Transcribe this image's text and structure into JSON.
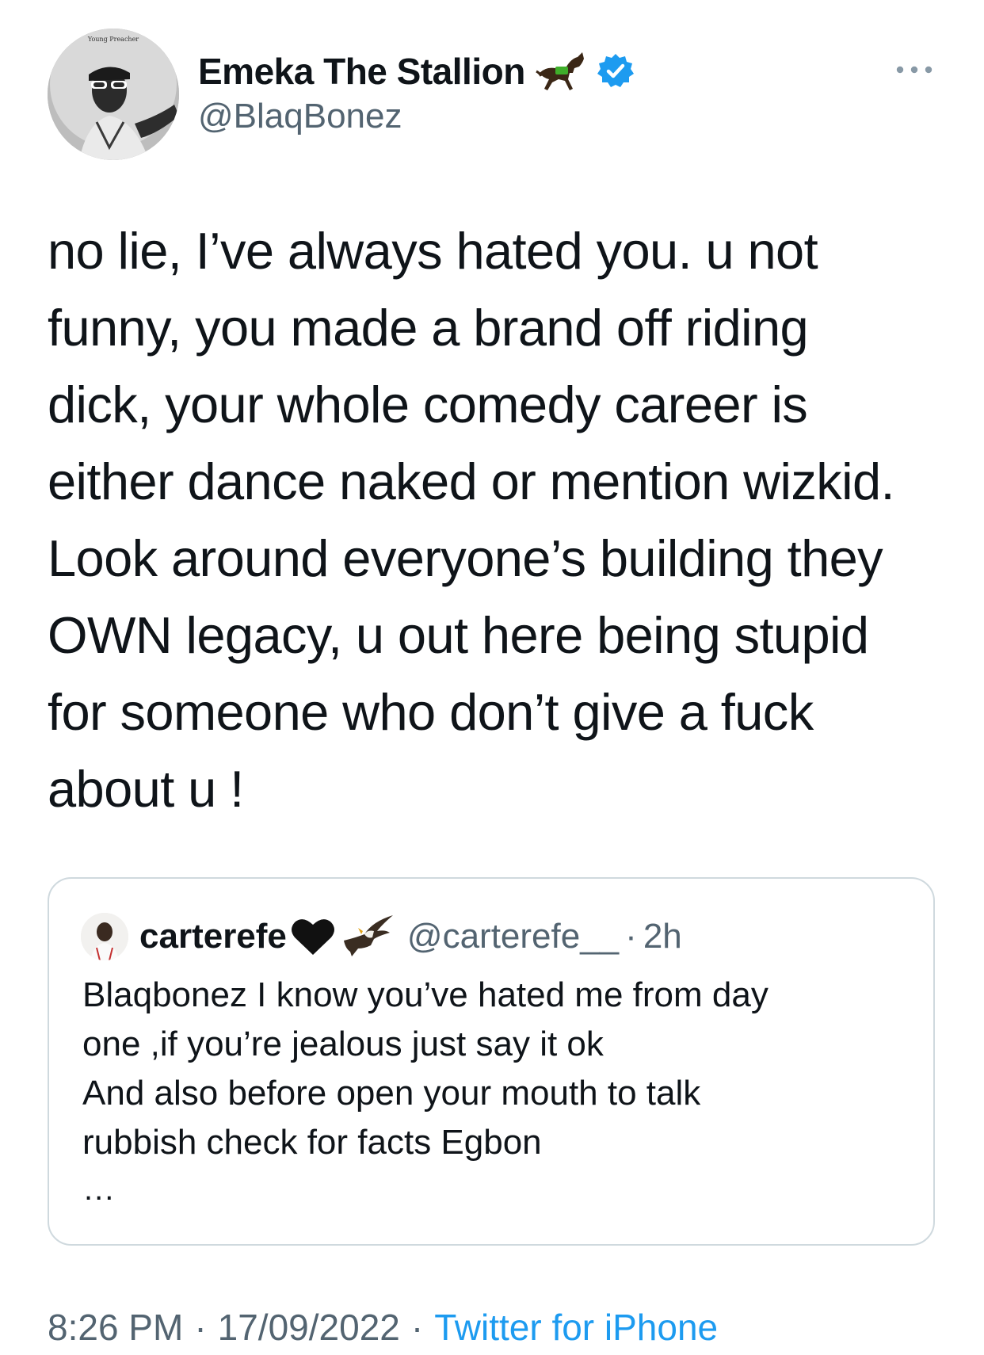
{
  "author": {
    "name": "Emeka The Stallion",
    "handle": "@BlaqBonez",
    "avatar_caption": "Young Preacher",
    "name_emoji": "horse-icon",
    "verified": true
  },
  "tweet": {
    "text": "no lie, I’ve always hated you. u not\nfunny, you made a brand off riding\ndick, your whole comedy career is\neither dance naked or mention wizkid.\nLook around everyone’s building they\nOWN legacy, u out here being stupid\nfor someone who don’t give a fuck\nabout u !"
  },
  "quote": {
    "name": "carterefe",
    "name_emojis": [
      "black-heart-icon",
      "eagle-icon"
    ],
    "handle": "@carterefe__",
    "separator": "·",
    "time": "2h",
    "text": "Blaqbonez I know you’ve hated me from day\none ,if you’re jealous just say it ok\nAnd also before open your mouth to talk\nrubbish check for facts Egbon",
    "more": "..."
  },
  "meta": {
    "time": "8:26 PM",
    "separator": "·",
    "date": "17/09/2022",
    "source": "Twitter for iPhone"
  },
  "colors": {
    "text": "#0f1419",
    "secondary": "#536471",
    "accent": "#1d9bf0",
    "border": "#cfd9de",
    "verified": "#1d9bf0"
  },
  "icons": {
    "more": "more-icon",
    "verified": "verified-badge-icon"
  }
}
